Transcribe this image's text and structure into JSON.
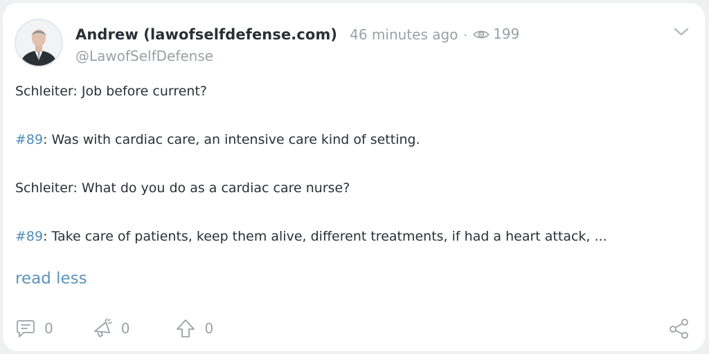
{
  "post": {
    "author": "Andrew (lawofselfdefense.com)",
    "time": "46 minutes ago",
    "separator": "·",
    "views": "199",
    "handle": "@LawofSelfDefense",
    "lines": [
      {
        "speaker": "Schleiter",
        "text": ": Job before current?"
      },
      {
        "speaker": "#89",
        "text": ": Was with cardiac care, an intensive care kind of setting."
      },
      {
        "speaker": "Schleiter",
        "text": ": What do you do as a cardiac care nurse?"
      },
      {
        "speaker": "#89",
        "text": ": Take care of patients, keep them alive, different treatments, if had a heart attack, ..."
      }
    ],
    "read_less": "read less"
  },
  "actions": {
    "comments": "0",
    "boosts": "0",
    "upvotes": "0"
  },
  "icons": {
    "views": "eye-icon",
    "menu": "chevron-down-icon",
    "comment": "comment-icon",
    "boost": "megaphone-icon",
    "upvote": "upvote-arrow-icon",
    "share": "share-icon"
  },
  "colors": {
    "link": "#4e8bb5",
    "muted": "#9aa0a7",
    "text": "#2a2f36"
  }
}
